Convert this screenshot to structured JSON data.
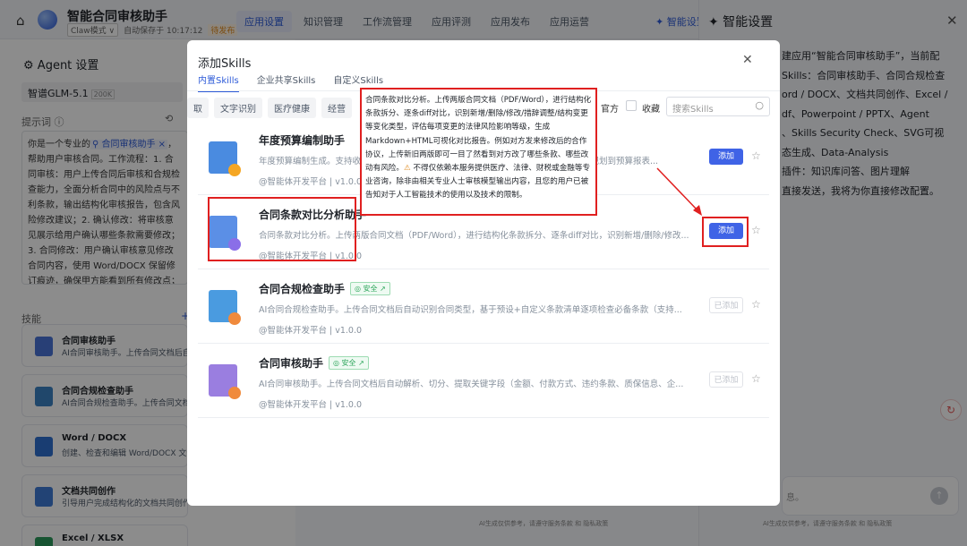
{
  "header": {
    "app_title": "智能合同审核助手",
    "mode": "Claw模式 ∨",
    "autosave": "自动保存于 10:17:12",
    "status": "待发布",
    "nav_tabs": [
      "应用设置",
      "知识管理",
      "工作流管理",
      "应用评测",
      "应用发布",
      "应用运营"
    ],
    "smart_link": "✦ 智能设置"
  },
  "left": {
    "title": "Agent 设置",
    "model": "智谱GLM-5.1",
    "model_badge": "200K",
    "prompt_label": "提示词 ⓘ",
    "prompt_before_tag": "你是一个专业的",
    "prompt_tag": "⚲ 合同审核助手 ×",
    "prompt_after_tag": "，帮助用户审核合同。工作流程：1. 合同审核：用户上传合同后审核和合规检查能力，全面分析合同中的风险点与不利条款，输出结构化审核报告，包含风险修改建议；2. 确认修改：将审核意见展示给用户确认哪些条款需要修改；3. 合同修改：用户确认审核意见修改合同内容，使用 Word/DOCX 保留修订痕迹，确保甲方能看到所有修改点；输出一份带有修订痕迹的 Word 合同文件，合比例，付款条件和期限，知识产权归属",
    "skills_label": "技能",
    "skills_plus": "+",
    "skills": [
      {
        "name": "合同审核助手",
        "desc": "AI合同审核助手。上传合同文档后自动",
        "color": "#4a74d8"
      },
      {
        "name": "合同合规检查助手",
        "desc": "AI合同合规检查助手。上传合同文档",
        "color": "#3b82c4"
      },
      {
        "name": "Word / DOCX",
        "desc": "创建、检查和编辑 Word/DOCX 文件",
        "color": "#2f6fd0"
      },
      {
        "name": "文档共同创作",
        "desc": "引导用户完成结构化的文档共同创作",
        "color": "#3e7ad6"
      },
      {
        "name": "Excel / XLSX",
        "desc": "",
        "color": "#2a9a5b"
      }
    ]
  },
  "right": {
    "title": "✦ 智能设置",
    "close": "✕",
    "text_lines": [
      "建应用“智能合同审核助手”，当前配",
      "",
      "Skills：合同审核助手、合同合规检查",
      "ord / DOCX、文档共同创作、Excel /",
      "df、Powerpoint / PPTX、Agent",
      "、Skills Security Check、SVG可视",
      "态生成、Data-Analysis",
      "插件：知识库问答、图片理解",
      "",
      "直接发送，我将为你直接修改配置。"
    ],
    "input_placeholder": "息。",
    "send": "↑",
    "footer": "AI生成仅供参考，请遵守服务条款 和 隐私政策"
  },
  "center_footer": "AI生成仅供参考，请遵守服务条款 和 隐私政策",
  "float_icon": "↻",
  "modal": {
    "title": "添加Skills",
    "close": "✕",
    "tabs": [
      "内置Skills",
      "企业共享Skills",
      "自定义Skills"
    ],
    "chips": [
      "取",
      "文字识别",
      "医疗健康",
      "经营"
    ],
    "official": "官方",
    "favorite": "收藏",
    "search_placeholder": "搜索Skills",
    "search_icon": "○",
    "skills": [
      {
        "name": "年度预算编制助手",
        "desc": "年度预算编制生成。支持收集各部门预算需求，汇总编制完整的年度预算报告，辅助预算规划到预算报表...",
        "source": "@智能体开发平台 | v1.0.0",
        "safe": "",
        "button": "添加",
        "enabled": true,
        "icon_color": "#4a8be0",
        "accent": "#f5a623"
      },
      {
        "name": "合同条款对比分析助手",
        "desc": "合同条款对比分析。上传两版合同文档（PDF/Word），进行结构化条款拆分、逐条diff对比，识别新增/删除/修改...",
        "source": "@智能体开发平台 | v1.0.0",
        "safe": "",
        "button": "添加",
        "enabled": true,
        "icon_color": "#5b8fe6",
        "accent": "#8a6ee8"
      },
      {
        "name": "合同合规检查助手",
        "desc": "AI合同合规检查助手。上传合同文档后自动识别合同类型，基于预设+自定义条款清单逐项检查必备条款（支持...",
        "source": "@智能体开发平台 | v1.0.0",
        "safe": "◎ 安全 ↗",
        "button": "已添加",
        "enabled": false,
        "icon_color": "#4a9be0",
        "accent": "#f08a3c"
      },
      {
        "name": "合同审核助手",
        "desc": "AI合同审核助手。上传合同文档后自动解析、切分、提取关键字段（金额、付款方式、违约条款、质保信息、企...",
        "source": "@智能体开发平台 | v1.0.0",
        "safe": "◎ 安全 ↗",
        "button": "已添加",
        "enabled": false,
        "icon_color": "#9a7ee0",
        "accent": "#f08a3c"
      }
    ],
    "star": "☆"
  },
  "tooltip": {
    "text": "合同条款对比分析。上传两版合同文档（PDF/Word），进行结构化条款拆分、逐条diff对比，识别新增/删除/修改/措辞调整/结构变更等变化类型，评估每项变更的法律风险影响等级，生成Markdown+HTML可视化对比报告。例如对方发来修改后的合作协议，上传新旧两版即可一目了然看到对方改了哪些条款、哪些改动有风险。",
    "warn": "⚠",
    "disclaimer": " 不得仅依赖本服务提供医疗、法律、财税或金融等专业咨询，除非由相关专业人士审核模型输出内容，且您的用户已被告知对于人工智能技术的使用以及技术的限制。"
  }
}
